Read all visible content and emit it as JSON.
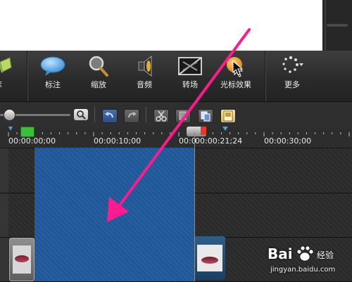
{
  "toolbar": {
    "partial_label": "库",
    "items": [
      {
        "label": "标注",
        "icon": "callout-icon"
      },
      {
        "label": "缩放",
        "icon": "zoom-icon"
      },
      {
        "label": "音频",
        "icon": "audio-icon"
      },
      {
        "label": "转场",
        "icon": "transition-icon"
      },
      {
        "label": "光标效果",
        "icon": "cursor-effects-icon"
      },
      {
        "label": "更多",
        "icon": "more-icon"
      }
    ]
  },
  "ruler": {
    "timecodes": [
      "00:00:00;00",
      "00:00:10;00",
      "00:0",
      "00:00:21;24",
      "00:00:30;00"
    ]
  },
  "watermark": {
    "brand": "Bai",
    "brand_suffix": "经验",
    "url": "jingyan.baidu.com"
  },
  "colors": {
    "selection": "#1e5aa0",
    "arrow": "#ff1b8d",
    "playhead": "#e33a2c",
    "marker_green": "#3bbf3b"
  }
}
